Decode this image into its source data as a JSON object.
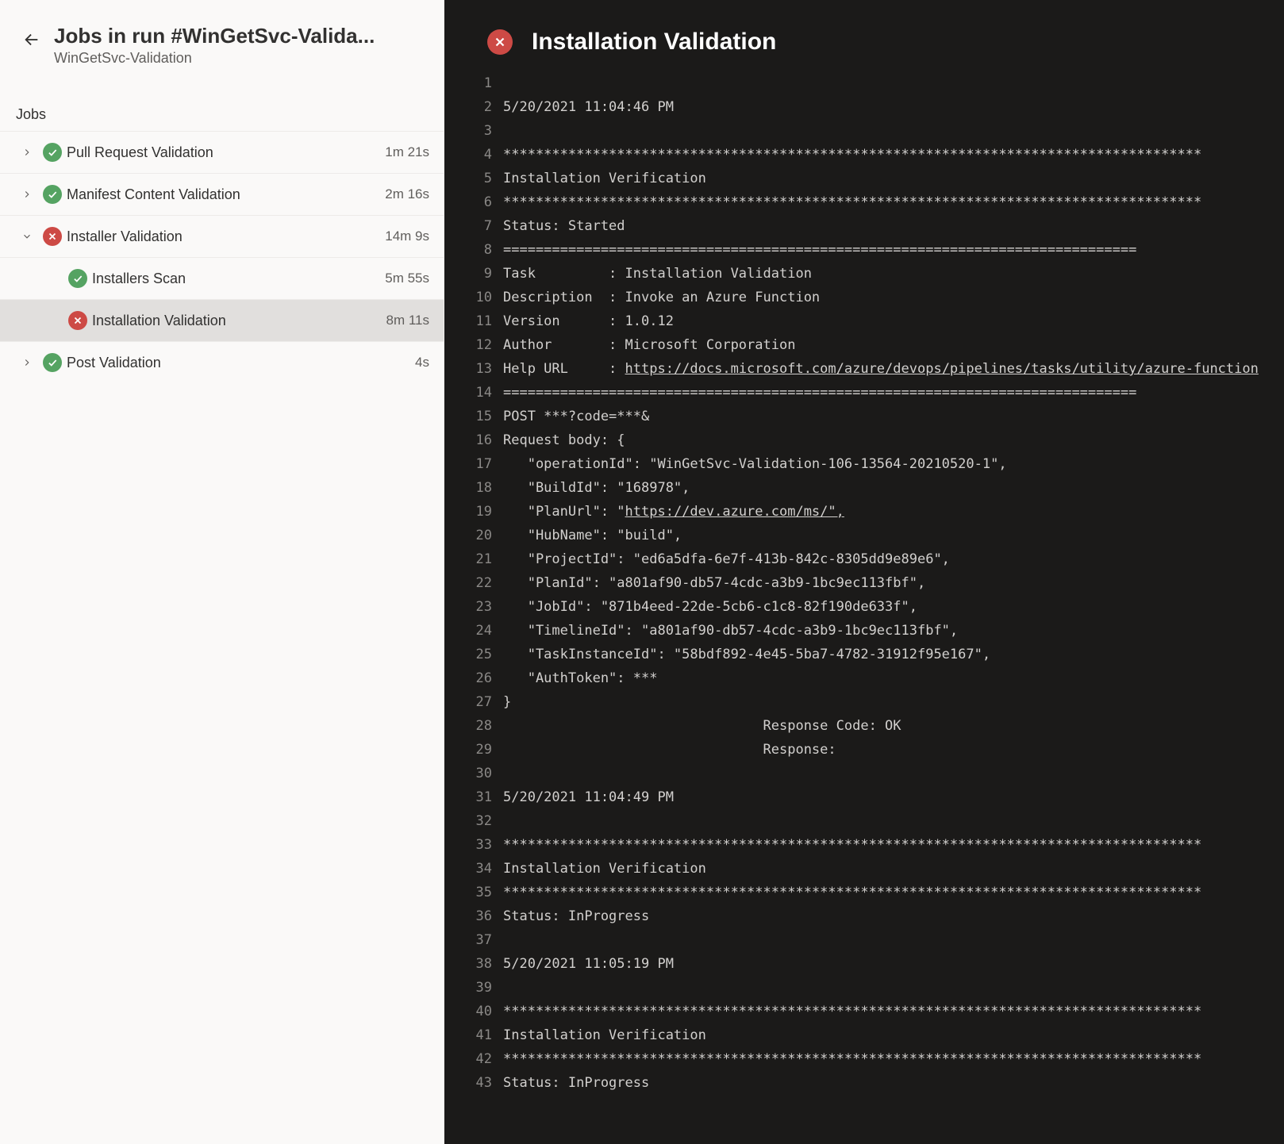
{
  "header": {
    "title": "Jobs in run #WinGetSvc-Valida...",
    "subtitle": "WinGetSvc-Validation",
    "section_label": "Jobs"
  },
  "jobs": [
    {
      "id": "pr-validation",
      "label": "Pull Request Validation",
      "duration": "1m 21s",
      "status": "success",
      "expandable": true,
      "expanded": false,
      "child": false,
      "selected": false
    },
    {
      "id": "manifest-validation",
      "label": "Manifest Content Validation",
      "duration": "2m 16s",
      "status": "success",
      "expandable": true,
      "expanded": false,
      "child": false,
      "selected": false
    },
    {
      "id": "installer-validation",
      "label": "Installer Validation",
      "duration": "14m 9s",
      "status": "fail",
      "expandable": true,
      "expanded": true,
      "child": false,
      "selected": false
    },
    {
      "id": "installers-scan",
      "label": "Installers Scan",
      "duration": "5m 55s",
      "status": "success",
      "expandable": false,
      "expanded": false,
      "child": true,
      "selected": false
    },
    {
      "id": "installation-validation",
      "label": "Installation Validation",
      "duration": "8m 11s",
      "status": "fail",
      "expandable": false,
      "expanded": false,
      "child": true,
      "selected": true
    },
    {
      "id": "post-validation",
      "label": "Post Validation",
      "duration": "4s",
      "status": "success",
      "expandable": true,
      "expanded": false,
      "child": false,
      "selected": false
    }
  ],
  "log": {
    "title": "Installation Validation",
    "status": "fail",
    "lines": [
      "",
      "5/20/2021 11:04:46 PM",
      "",
      "**************************************************************************************",
      "Installation Verification",
      "**************************************************************************************",
      "Status: Started",
      "==============================================================================",
      "Task         : Installation Validation",
      "Description  : Invoke an Azure Function",
      "Version      : 1.0.12",
      "Author       : Microsoft Corporation",
      {
        "prefix": "Help URL     : ",
        "link": "https://docs.microsoft.com/azure/devops/pipelines/tasks/utility/azure-function"
      },
      "==============================================================================",
      "POST ***?code=***&",
      "Request body: {",
      "   \"operationId\": \"WinGetSvc-Validation-106-13564-20210520-1\",",
      "   \"BuildId\": \"168978\",",
      {
        "prefix": "   \"PlanUrl\": \"",
        "link": "https://dev.azure.com/ms/\",",
        "linkText": "https://dev.azure.com/ms/\","
      },
      "   \"HubName\": \"build\",",
      "   \"ProjectId\": \"ed6a5dfa-6e7f-413b-842c-8305dd9e89e6\",",
      "   \"PlanId\": \"a801af90-db57-4cdc-a3b9-1bc9ec113fbf\",",
      "   \"JobId\": \"871b4eed-22de-5cb6-c1c8-82f190de633f\",",
      "   \"TimelineId\": \"a801af90-db57-4cdc-a3b9-1bc9ec113fbf\",",
      "   \"TaskInstanceId\": \"58bdf892-4e45-5ba7-4782-31912f95e167\",",
      "   \"AuthToken\": ***",
      "}",
      "                                Response Code: OK",
      "                                Response:",
      "",
      "5/20/2021 11:04:49 PM",
      "",
      "**************************************************************************************",
      "Installation Verification",
      "**************************************************************************************",
      "Status: InProgress",
      "",
      "5/20/2021 11:05:19 PM",
      "",
      "**************************************************************************************",
      "Installation Verification",
      "**************************************************************************************",
      "Status: InProgress"
    ]
  }
}
